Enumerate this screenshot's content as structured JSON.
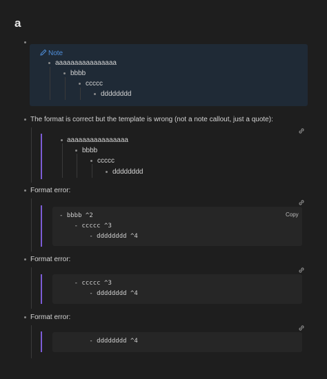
{
  "heading": "a",
  "note": {
    "label": "Note",
    "items": [
      "aaaaaaaaaaaaaaaa",
      "bbbb",
      "ccccc",
      "dddddddd"
    ]
  },
  "item1": {
    "text": "The format is correct but the template is wrong (not a note callout, just a quote):",
    "items": [
      "aaaaaaaaaaaaaaaa",
      "bbbb",
      "ccccc",
      "dddddddd"
    ]
  },
  "item2": {
    "text": "Format error:",
    "copy_label": "Copy",
    "code": [
      "- bbbb ^2",
      "    - ccccc ^3",
      "        - dddddddd ^4"
    ]
  },
  "item3": {
    "text": "Format error:",
    "code": [
      "    - ccccc ^3",
      "        - dddddddd ^4"
    ]
  },
  "item4": {
    "text": "Format error:",
    "code": [
      "        - dddddddd ^4"
    ]
  },
  "colors": {
    "background": "#1e1e1e",
    "callout_bg": "#1f2a36",
    "note_accent": "#4f8fdb",
    "quote_bar": "#7c5cd6",
    "code_bg": "#262626"
  }
}
